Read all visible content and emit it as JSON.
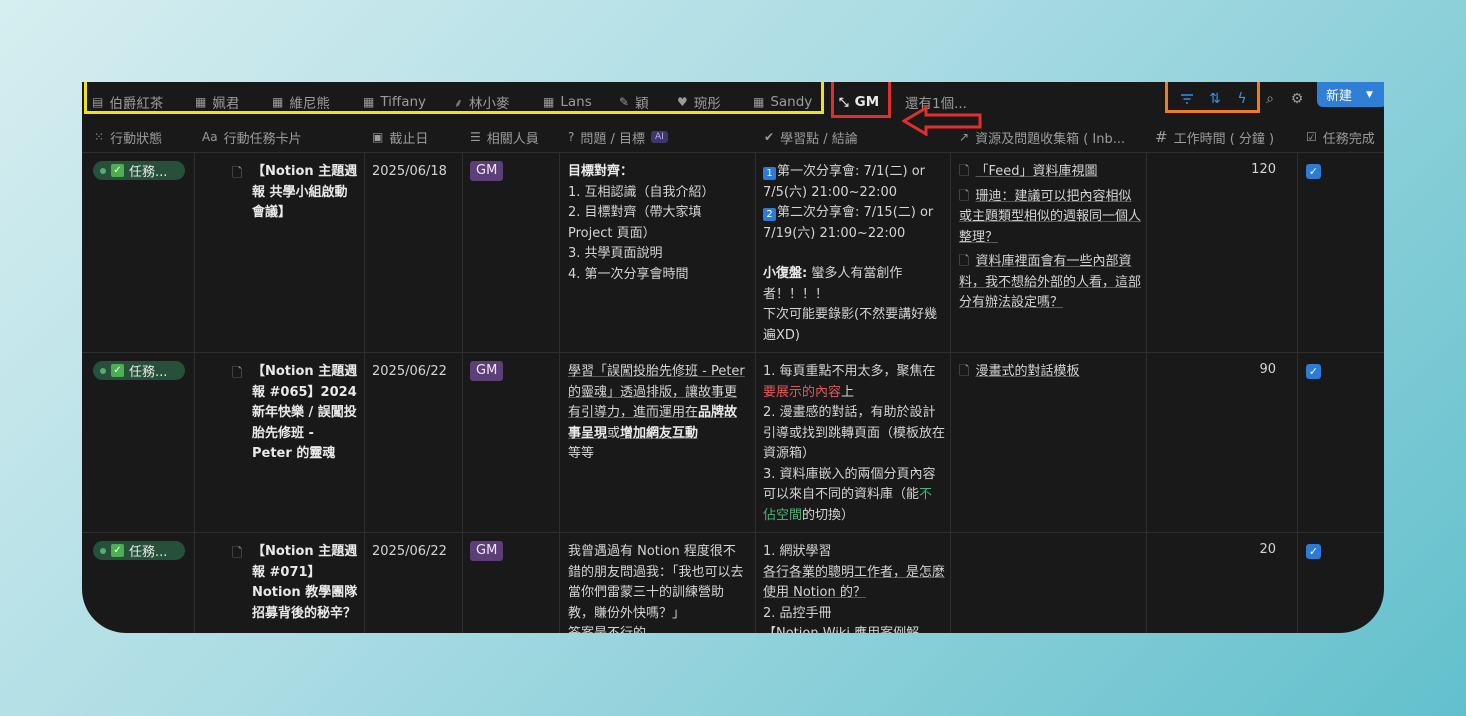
{
  "tabs": [
    {
      "icon": "table-icon",
      "label": "伯爵紅茶"
    },
    {
      "icon": "table-icon",
      "label": "姵君"
    },
    {
      "icon": "table-icon",
      "label": "維尼熊"
    },
    {
      "icon": "table-icon",
      "label": "Tiffany"
    },
    {
      "icon": "wheat-icon",
      "label": "林小麥"
    },
    {
      "icon": "table-icon",
      "label": "Lans"
    },
    {
      "icon": "brush-icon",
      "label": "穎"
    },
    {
      "icon": "heart-icon",
      "label": "琬彤"
    },
    {
      "icon": "table-icon",
      "label": "Sandy"
    },
    {
      "icon": "shrink-icon",
      "label": "GM",
      "active": true
    }
  ],
  "more_tabs": "還有1個...",
  "new_button": "新建",
  "highlight_colors": {
    "yellow": "#f0e11e",
    "red": "#e0302b",
    "orange": "#ee7c22"
  },
  "columns": [
    {
      "icon": "status-icon",
      "label": "行動狀態"
    },
    {
      "icon": "title-icon",
      "label": "行動任務卡片"
    },
    {
      "icon": "calendar-icon",
      "label": "截止日"
    },
    {
      "icon": "list-icon",
      "label": "相關人員"
    },
    {
      "icon": "question-icon",
      "label": "問題 / 目標",
      "badge": "AI"
    },
    {
      "icon": "check-circle-icon",
      "label": "學習點 / 結論"
    },
    {
      "icon": "relation-arrow-icon",
      "label": "資源及問題收集箱 ( Inb..."
    },
    {
      "icon": "hash-icon",
      "label": "工作時間 ( 分鐘 )"
    },
    {
      "icon": "checkbox-icon",
      "label": "任務完成"
    }
  ],
  "rows": [
    {
      "status": "任務...",
      "title": "【Notion 主題週報 共學小組啟動會議】",
      "date": "2025/06/18",
      "person": "GM",
      "goal_heading": "目標對齊：",
      "goal": "1. 互相認識（自我介紹）\n2. 目標對齊（帶大家填 Project 頁面）\n3. 共學頁面說明\n4. 第一次分享會時間",
      "learn_1": "第一次分享會: 7/1(二) or 7/5(六) 21:00~22:00",
      "learn_2": "第二次分享會: 7/15(二) or 7/19(六) 21:00~22:00",
      "learn_review_label": "小復盤:",
      "learn_review": " 蠻多人有當創作者！！！！",
      "learn_next": "下次可能要錄影(不然要講好幾遍XD)",
      "refs": [
        "「Feed」資料庫視圖",
        "珊迪：建議可以把內容相似或主題類型相似的週報同一個人整理？",
        "資料庫裡面會有一些內部資料，我不想給外部的人看，這部分有辦法設定嗎？"
      ],
      "minutes": "120",
      "done": true
    },
    {
      "status": "任務...",
      "title": "【Notion 主題週報 #065】2024 新年快樂 / 誤闖投胎先修班 - Peter 的靈魂",
      "date": "2025/06/22",
      "person": "GM",
      "goal_a": "學習「誤闖投胎先修班 - Peter 的靈魂」透過排版，讓故事更有引導力，進而運用在",
      "goal_b": "品牌故事呈現",
      "goal_c": "或",
      "goal_d": "增加網友互動",
      "goal_e": "等等",
      "learn_a": "1. 每頁重點不用太多，聚焦在",
      "learn_b": "要展示的內容",
      "learn_c": "上\n2. 漫畫感的對話，有助於設計引導或找到跳轉頁面（模板放在資源箱）\n3. 資料庫嵌入的兩個分頁內容可以來自不同的資料庫（能",
      "learn_d": "不佔空間",
      "learn_e": "的切換）",
      "refs": [
        "漫畫式的對話模板"
      ],
      "minutes": "90",
      "done": true
    },
    {
      "status": "任務...",
      "title": "【Notion 主題週報 #071】Notion 教學團隊招募背後的秘辛？",
      "date": "2025/06/22",
      "person": "GM",
      "goal": "我曾遇過有 Notion 程度很不錯的朋友問過我：「我也可以去當你們雷蒙三十的訓練營助教，賺份外快嗎？」\n答案是不行的。",
      "learn_a": "1. 網狀學習",
      "learn_b": "各行各業的聰明工作者，是怎麼使用 Notion 的？",
      "learn_c": "2. 品控手冊",
      "learn_d": "【Notion Wiki 應用案例解",
      "minutes": "20",
      "done": true
    }
  ]
}
